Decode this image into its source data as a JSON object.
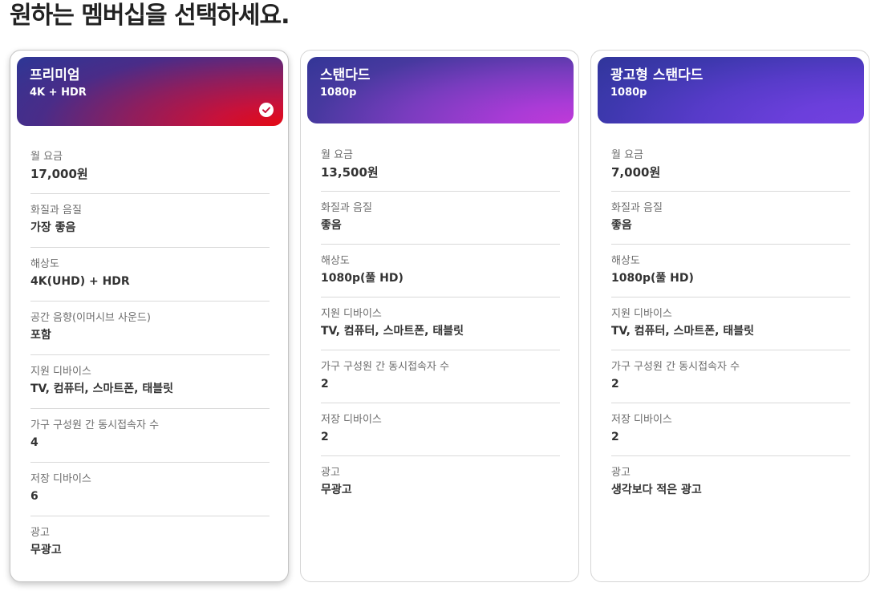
{
  "page": {
    "title": "원하는 멤버십을 선택하세요."
  },
  "plans": [
    {
      "name": "프리미엄",
      "resolution_badge": "4K + HDR",
      "selected": true,
      "attributes": [
        {
          "label": "월 요금",
          "value": "17,000원"
        },
        {
          "label": "화질과 음질",
          "value": "가장 좋음"
        },
        {
          "label": "해상도",
          "value": "4K(UHD) + HDR"
        },
        {
          "label": "공간 음향(이머시브 사운드)",
          "value": "포함"
        },
        {
          "label": "지원 디바이스",
          "value": "TV, 컴퓨터, 스마트폰, 태블릿"
        },
        {
          "label": "가구 구성원 간 동시접속자 수",
          "value": "4"
        },
        {
          "label": "저장 디바이스",
          "value": "6"
        },
        {
          "label": "광고",
          "value": "무광고"
        }
      ]
    },
    {
      "name": "스탠다드",
      "resolution_badge": "1080p",
      "selected": false,
      "attributes": [
        {
          "label": "월 요금",
          "value": "13,500원"
        },
        {
          "label": "화질과 음질",
          "value": "좋음"
        },
        {
          "label": "해상도",
          "value": "1080p(풀 HD)"
        },
        {
          "label": "지원 디바이스",
          "value": "TV, 컴퓨터, 스마트폰, 태블릿"
        },
        {
          "label": "가구 구성원 간 동시접속자 수",
          "value": "2"
        },
        {
          "label": "저장 디바이스",
          "value": "2"
        },
        {
          "label": "광고",
          "value": "무광고"
        }
      ]
    },
    {
      "name": "광고형 스탠다드",
      "resolution_badge": "1080p",
      "selected": false,
      "attributes": [
        {
          "label": "월 요금",
          "value": "7,000원"
        },
        {
          "label": "화질과 음질",
          "value": "좋음"
        },
        {
          "label": "해상도",
          "value": "1080p(풀 HD)"
        },
        {
          "label": "지원 디바이스",
          "value": "TV, 컴퓨터, 스마트폰, 태블릿"
        },
        {
          "label": "가구 구성원 간 동시접속자 수",
          "value": "2"
        },
        {
          "label": "저장 디바이스",
          "value": "2"
        },
        {
          "label": "광고",
          "value": "생각보다 적은 광고"
        }
      ]
    }
  ],
  "icons": {
    "selected_check": "check-circle-icon"
  },
  "colors": {
    "premium_gradient_end": "#e50914",
    "standard_gradient_end": "#c03ad8",
    "ads_gradient_end": "#7340e0",
    "gradient_start": "#2c3594"
  }
}
